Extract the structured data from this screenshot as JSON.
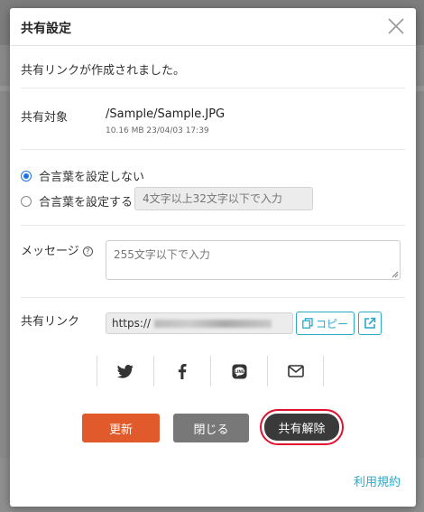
{
  "dialog": {
    "title": "共有設定",
    "message": "共有リンクが作成されました。",
    "target": {
      "label": "共有対象",
      "path": "/Sample/Sample.JPG",
      "meta": "10.16 MB 23/04/03 17:39"
    },
    "passphrase": {
      "option_none": "合言葉を設定しない",
      "option_set": "合言葉を設定する",
      "placeholder": "4文字以上32文字以下で入力",
      "selected": "none"
    },
    "message_field": {
      "label": "メッセージ",
      "placeholder": "255文字以下で入力"
    },
    "link": {
      "label": "共有リンク",
      "value_prefix": "https://",
      "copy_label": "コピー"
    },
    "share_icons": [
      "twitter-icon",
      "facebook-icon",
      "line-icon",
      "mail-icon"
    ],
    "buttons": {
      "update": "更新",
      "close": "閉じる",
      "unshare": "共有解除"
    },
    "terms": "利用規約"
  },
  "colors": {
    "accent": "#2aa9c9",
    "update": "#e05a2b",
    "close": "#787878",
    "unshare": "#3a3a3a",
    "highlight_ring": "#e0102e",
    "radio": "#1a73e8"
  }
}
